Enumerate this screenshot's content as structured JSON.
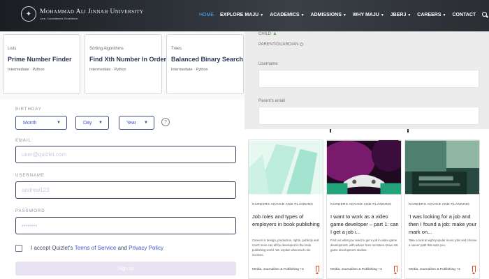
{
  "nav": {
    "logo_name": "Mohammad Ali Jinnah University",
    "logo_tagline": "Lore, Commitment, Excellence",
    "items": [
      {
        "label": "HOME",
        "active": true,
        "dropdown": false
      },
      {
        "label": "EXPLORE MAJU",
        "active": false,
        "dropdown": true
      },
      {
        "label": "ACADEMICS",
        "active": false,
        "dropdown": true
      },
      {
        "label": "ADMISSIONS",
        "active": false,
        "dropdown": true
      },
      {
        "label": "WHY MAJU",
        "active": false,
        "dropdown": true
      },
      {
        "label": "JBERJ",
        "active": false,
        "dropdown": true
      },
      {
        "label": "CAREERS",
        "active": false,
        "dropdown": true
      },
      {
        "label": "CONTACT",
        "active": false,
        "dropdown": false
      }
    ]
  },
  "cards": [
    {
      "category": "Lists",
      "title": "Prime Number Finder",
      "meta": "Intermediate · Python"
    },
    {
      "category": "Sorting Algorithms",
      "title": "Find Xth Number In Order",
      "meta": "Intermediate · Python"
    },
    {
      "category": "Trees",
      "title": "Balanced Binary Search Tree",
      "meta": "Intermediate · Python"
    }
  ],
  "signup": {
    "birthday_label": "BIRTHDAY",
    "month": "Month",
    "day": "Day",
    "year": "Year",
    "email_label": "EMAIL",
    "email_placeholder": "user@quizlet.com",
    "username_label": "USERNAME",
    "username_placeholder": "andrew123",
    "password_label": "PASSWORD",
    "password_placeholder": "••••••••",
    "terms_prefix": "I accept Quizlet's",
    "terms_link": "Terms of Service",
    "terms_and": "and",
    "privacy_link": "Privacy Policy",
    "button": "Sign up"
  },
  "contact_form": {
    "child_label": "CHILD",
    "parent_label": "PARENT/GUARDIAN",
    "username_label": "Username",
    "parent_email_label": "Parent's email"
  },
  "articles": [
    {
      "category": "CAREERS ADVICE AND PLANNING",
      "title": "Job roles and types of employers in book publishing",
      "description": "Careers in design, production, rights, publicity and much more can all be developed in the book publishing world. We explain what each role involves.",
      "tag": "Media, Journalism & Publishing +3",
      "image_colors": [
        "#d9f4ea",
        "#b8eadb",
        "#8fdcc6"
      ]
    },
    {
      "category": "CAREERS ADVICE AND PLANNING",
      "title": "I want to work as a video game developer – part 1: can I get a job i...",
      "description": "Find out what you need to get a job in video game development, with advice from recruiters at two UK game development studios.",
      "tag": "Media, Journalism & Publishing +3",
      "image_colors": [
        "#2b0a2c",
        "#8e1f7a",
        "#1ba87a"
      ]
    },
    {
      "category": "CAREERS ADVICE AND PLANNING",
      "title": "'I was looking for a job and then I found a job: make your mark on...",
      "description": "Take a look at eight popular music jobs and choose a career path that suits you.",
      "tag": "Media, Journalism & Publishing +3",
      "image_colors": [
        "#1c3a34",
        "#3f6f63",
        "#a9c9b8"
      ]
    }
  ]
}
